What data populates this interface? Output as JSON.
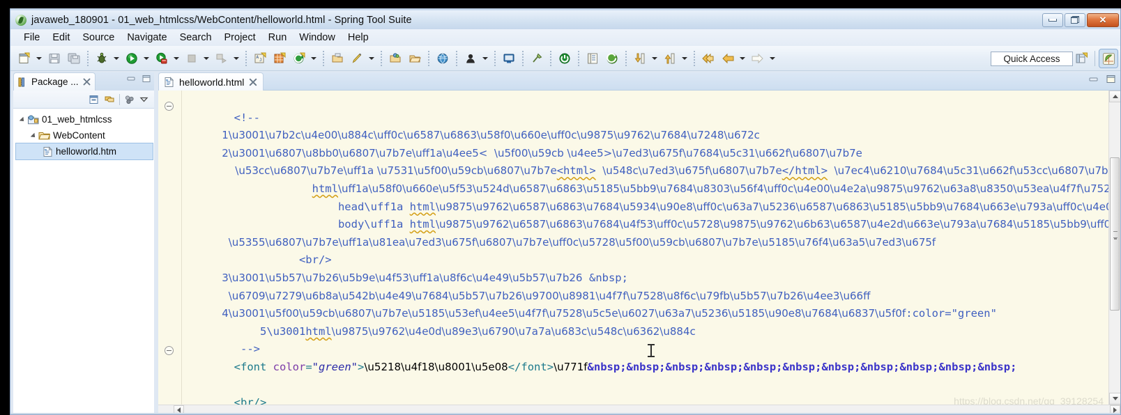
{
  "window": {
    "title": "javaweb_180901 - 01_web_htmlcss/WebContent/helloworld.html - Spring Tool Suite",
    "app_icon": "spring-leaf-icon",
    "controls": {
      "minimize": "minimize-button",
      "restore": "restore-button",
      "close": "✕"
    }
  },
  "menubar": {
    "items": [
      {
        "label": "File"
      },
      {
        "label": "Edit"
      },
      {
        "label": "Source"
      },
      {
        "label": "Navigate"
      },
      {
        "label": "Search"
      },
      {
        "label": "Project"
      },
      {
        "label": "Run"
      },
      {
        "label": "Window"
      },
      {
        "label": "Help"
      }
    ]
  },
  "toolbar": {
    "groups": [
      {
        "buttons": [
          {
            "icon": "new-wizard-icon",
            "dropdown": true
          },
          {
            "icon": "save-icon",
            "dropdown": false
          },
          {
            "icon": "save-all-icon",
            "dropdown": false
          }
        ]
      },
      {
        "buttons": [
          {
            "icon": "debug-icon",
            "dropdown": true
          },
          {
            "icon": "run-icon",
            "dropdown": true
          },
          {
            "icon": "run-server-icon",
            "dropdown": true
          },
          {
            "icon": "stop-icon",
            "dropdown": true
          },
          {
            "icon": "external-tools-icon",
            "dropdown": true
          }
        ]
      },
      {
        "buttons": [
          {
            "icon": "new-java-package-icon",
            "dropdown": false
          },
          {
            "icon": "new-grid-icon",
            "dropdown": false
          },
          {
            "icon": "new-spring-element-icon",
            "dropdown": true
          }
        ]
      },
      {
        "buttons": [
          {
            "icon": "open-type-icon",
            "dropdown": false
          },
          {
            "icon": "quick-fix-icon",
            "dropdown": true
          }
        ]
      },
      {
        "buttons": [
          {
            "icon": "open-resource-icon",
            "dropdown": false
          },
          {
            "icon": "open-folder-icon",
            "dropdown": false
          }
        ]
      },
      {
        "buttons": [
          {
            "icon": "web-browser-icon",
            "dropdown": false
          }
        ]
      },
      {
        "buttons": [
          {
            "icon": "user-profile-icon",
            "dropdown": true
          }
        ]
      },
      {
        "buttons": [
          {
            "icon": "console-icon",
            "dropdown": false
          }
        ]
      },
      {
        "buttons": [
          {
            "icon": "pin-icon",
            "dropdown": false
          }
        ]
      },
      {
        "buttons": [
          {
            "icon": "power-icon",
            "dropdown": false
          }
        ]
      },
      {
        "buttons": [
          {
            "icon": "report-icon",
            "dropdown": false
          },
          {
            "icon": "spring-boot-icon",
            "dropdown": false
          }
        ]
      },
      {
        "buttons": [
          {
            "icon": "next-annotation-icon",
            "dropdown": true
          },
          {
            "icon": "previous-annotation-icon",
            "dropdown": true
          }
        ]
      },
      {
        "buttons": [
          {
            "icon": "back-icon",
            "dropdown": false
          },
          {
            "icon": "forward-back-icon",
            "dropdown": true
          },
          {
            "icon": "forward-icon",
            "dropdown": true
          }
        ]
      }
    ],
    "quick_access": {
      "label": "Quick Access",
      "placeholder": "Quick Access"
    },
    "perspectives": [
      {
        "icon": "open-perspective-icon",
        "active": false
      },
      {
        "icon": "spring-perspective-icon",
        "active": true
      }
    ]
  },
  "package_explorer": {
    "tab_label": "Package ...",
    "tab_icon": "package-explorer-icon",
    "close_icon": "close-icon",
    "view_minimize": "minimize-view-button",
    "view_maximize": "maximize-view-button",
    "toolbar_icons": [
      "collapse-all-icon",
      "link-with-editor-icon",
      "view-menu-dots-icon",
      "view-menu-chevron-icon"
    ],
    "tree": [
      {
        "label": "01_web_htmlcss",
        "icon": "java-project-icon",
        "depth": 0,
        "expanded": true,
        "selected": false
      },
      {
        "label": "WebContent",
        "icon": "folder-icon",
        "depth": 1,
        "expanded": true,
        "selected": false
      },
      {
        "label": "helloworld.htm",
        "icon": "html-file-icon",
        "depth": 2,
        "expanded": false,
        "selected": true
      }
    ]
  },
  "editor": {
    "tab": {
      "label": "helloworld.html",
      "icon": "html-file-icon",
      "close_icon": "close-icon"
    },
    "view_minimize": "minimize-view-button",
    "view_maximize": "maximize-view-button",
    "fold_markers": [
      {
        "name": "fold-marker-comment"
      },
      {
        "name": "fold-marker-font"
      }
    ],
    "code_lines": [
      {
        "id": "l0",
        "indent": 0,
        "text": "",
        "partial": true
      },
      {
        "id": "l1",
        "indent": 0,
        "text": "        <!--",
        "kind": "comment"
      },
      {
        "id": "l2",
        "indent": 0,
        "text": "            1、第一行，文档声明，页面的版本",
        "kind": "comment"
      },
      {
        "id": "l3",
        "indent": 0,
        "text": "            2、标记标签：以<  开始 以>结束的就是标签",
        "kind": "comment"
      },
      {
        "id": "l4",
        "indent": 0,
        "text": "                双标签： 由开始标签<html>  和结束标签</html>  组成的就是双标签，需要选中内部的所有内容",
        "kind": "comment"
      },
      {
        "id": "l5",
        "indent": 0,
        "text": "                    html：声明当前文档内容的范围，一个页面推荐只使用一个",
        "kind": "comment"
      },
      {
        "id": "l6",
        "indent": 0,
        "text": "                        head： html页面文档的头部，控制文档内容的显示，不在正文中显示让用户查看的内容写在头部中，使用少",
        "kind": "comment"
      },
      {
        "id": "l7",
        "indent": 0,
        "text": "                        body： html页面文档的体，在页面正文中显示的内容，一般标签都是在body中使用的",
        "kind": "comment"
      },
      {
        "id": "l8",
        "indent": 0,
        "text": "              单标签：自结束标签，在开始标签内直接结束",
        "kind": "comment"
      },
      {
        "id": "l9",
        "indent": 0,
        "text": "                  <br/>",
        "kind": "comment"
      },
      {
        "id": "l10",
        "indent": 0,
        "text": "            3、字符实体：转义字符  &nbsp;",
        "kind": "comment"
      },
      {
        "id": "l11",
        "indent": 0,
        "text": "              有特殊含义的字符需要使用转移字符代替",
        "kind": "comment"
      },
      {
        "id": "l12",
        "indent": 0,
        "text": "            4、开始标签内可以使用属性控制内部的样式:color=\"green\"",
        "kind": "comment"
      },
      {
        "id": "l13",
        "indent": 0,
        "text": "            5、html页面不解析空格和换行",
        "kind": "comment"
      },
      {
        "id": "l14",
        "indent": 0,
        "text": "         -->",
        "kind": "comment"
      },
      {
        "id": "l15",
        "indent": 0,
        "text": "",
        "kind": "markup"
      },
      {
        "id": "l16",
        "indent": 0,
        "text": "        <br/>",
        "kind": "markup"
      }
    ],
    "font_line": {
      "open_lt": "<",
      "tag_name": "font",
      "attr_name": "color",
      "attr_eq": "=",
      "attr_value": "\"green\"",
      "close_gt": ">",
      "inner_text": "刘优老师",
      "close_tag": "</font>",
      "after_text": "真",
      "entity": "&nbsp;",
      "entity_count": 11
    },
    "br_line": "<br/>",
    "scrollbar_vertical": {
      "up_arrow": "scroll-up-arrow",
      "down_arrow": "scroll-down-arrow",
      "thumb": "vertical-scroll-thumb"
    },
    "scrollbar_horizontal": {
      "left_arrow": "scroll-left-arrow",
      "right_arrow": "scroll-right-arrow"
    },
    "mouse_cursor": "text-ibeam-cursor"
  },
  "watermark": {
    "text": "https://blog.csdn.net/qq_39128254"
  },
  "colors": {
    "editor_background": "#fbf9e8",
    "comment_blue": "#3f5fbf",
    "tag_teal": "#1d7a8c",
    "attr_purple": "#7b3ba8",
    "value_blue": "#2a2aa8",
    "entity_indigo": "#3b34c9",
    "chrome_blue": "#cfdeef",
    "selection_blue": "#cfe3f7",
    "accent_green": "#4e9d3e"
  }
}
